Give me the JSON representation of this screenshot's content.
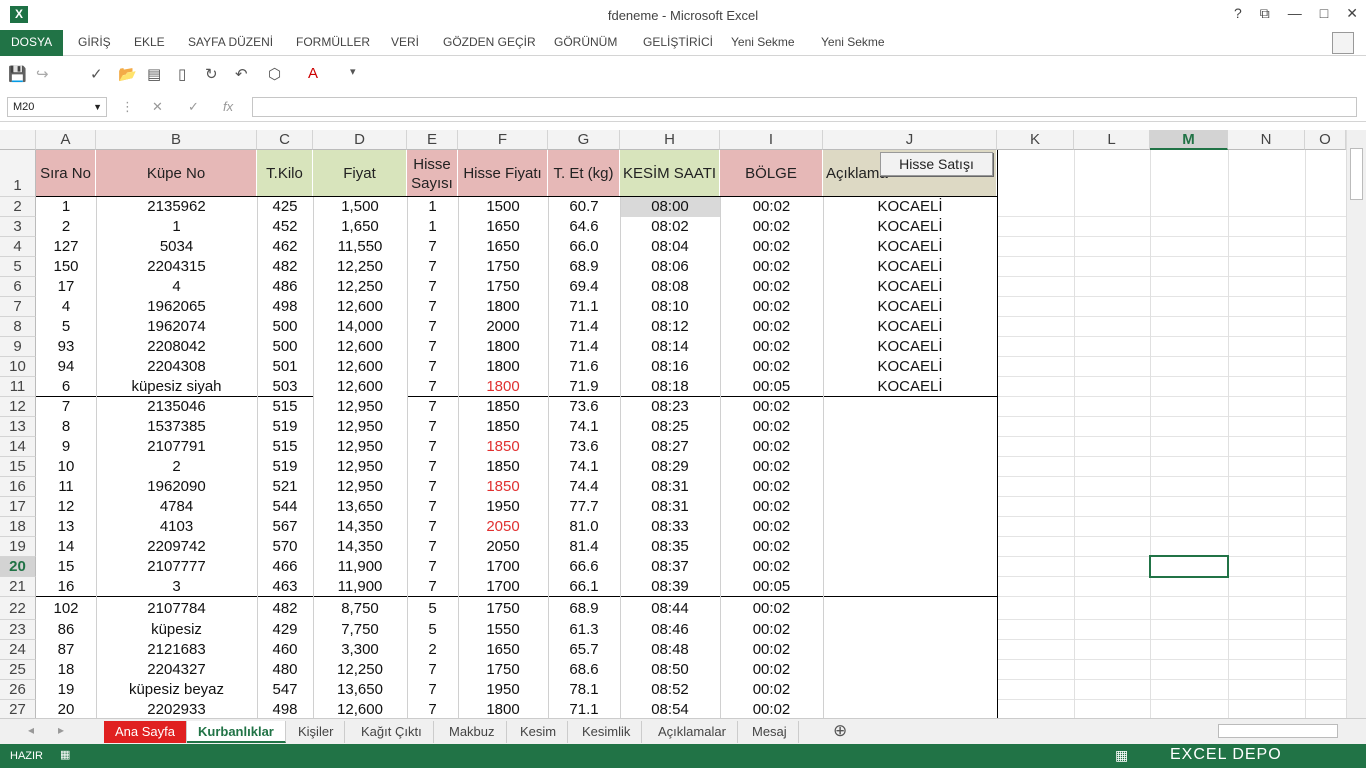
{
  "window": {
    "title": "fdeneme - Microsoft Excel",
    "help": "?",
    "controls": [
      "⧉",
      "—",
      "□",
      "✕"
    ]
  },
  "ribbon": {
    "file": "DOSYA",
    "tabs": [
      "GİRİŞ",
      "EKLE",
      "SAYFA DÜZENİ",
      "FORMÜLLER",
      "VERİ",
      "GÖZDEN GEÇİR",
      "GÖRÜNÜM",
      "GELİŞTİRİCİ",
      "Yeni Sekme",
      "Yeni Sekme"
    ]
  },
  "quick_access": [
    "save-icon",
    "redo-icon",
    "spellcheck-icon",
    "open-icon",
    "form-icon",
    "new-icon",
    "refresh-icon",
    "undo-icon",
    "shapes-icon",
    "font-color-icon",
    "customize-icon"
  ],
  "name_box": "M20",
  "formula_bar": {
    "cancel": "✕",
    "enter": "✓",
    "fx": "fx",
    "value": ""
  },
  "columns": [
    "A",
    "B",
    "C",
    "D",
    "E",
    "F",
    "G",
    "H",
    "I",
    "J",
    "K",
    "L",
    "M",
    "N",
    "O"
  ],
  "selected_column": "M",
  "selected_row": "20",
  "headers": {
    "A": "Sıra No",
    "B": "Küpe No",
    "C": "T.Kilo",
    "D": "Fiyat",
    "E": "Hisse Sayısı",
    "F": "Hisse Fiyatı",
    "G": "T. Et (kg)",
    "H": "KESİM SAATI",
    "I": "BÖLGE",
    "J": "Açıklama"
  },
  "button_label": "Hisse Satışı",
  "rows": [
    {
      "n": "2",
      "a": "1",
      "b": "2135962",
      "c": "425",
      "d": "1,500",
      "e": "1",
      "f": "1500",
      "g": "60.7",
      "h": "08:00",
      "i": "00:02",
      "j": "KOCAELİ"
    },
    {
      "n": "3",
      "a": "2",
      "b": "1",
      "c": "452",
      "d": "1,650",
      "e": "1",
      "f": "1650",
      "g": "64.6",
      "h": "08:02",
      "i": "00:02",
      "j": "KOCAELİ"
    },
    {
      "n": "4",
      "a": "127",
      "b": "5034",
      "c": "462",
      "d": "11,550",
      "e": "7",
      "f": "1650",
      "g": "66.0",
      "h": "08:04",
      "i": "00:02",
      "j": "KOCAELİ"
    },
    {
      "n": "5",
      "a": "150",
      "b": "2204315",
      "c": "482",
      "d": "12,250",
      "e": "7",
      "f": "1750",
      "g": "68.9",
      "h": "08:06",
      "i": "00:02",
      "j": "KOCAELİ"
    },
    {
      "n": "6",
      "a": "17",
      "b": "4",
      "c": "486",
      "d": "12,250",
      "e": "7",
      "f": "1750",
      "g": "69.4",
      "h": "08:08",
      "i": "00:02",
      "j": "KOCAELİ"
    },
    {
      "n": "7",
      "a": "4",
      "b": "1962065",
      "c": "498",
      "d": "12,600",
      "e": "7",
      "f": "1800",
      "g": "71.1",
      "h": "08:10",
      "i": "00:02",
      "j": "KOCAELİ"
    },
    {
      "n": "8",
      "a": "5",
      "b": "1962074",
      "c": "500",
      "d": "14,000",
      "e": "7",
      "f": "2000",
      "g": "71.4",
      "h": "08:12",
      "i": "00:02",
      "j": "KOCAELİ"
    },
    {
      "n": "9",
      "a": "93",
      "b": "2208042",
      "c": "500",
      "d": "12,600",
      "e": "7",
      "f": "1800",
      "g": "71.4",
      "h": "08:14",
      "i": "00:02",
      "j": "KOCAELİ"
    },
    {
      "n": "10",
      "a": "94",
      "b": "2204308",
      "c": "501",
      "d": "12,600",
      "e": "7",
      "f": "1800",
      "g": "71.6",
      "h": "08:16",
      "i": "00:02",
      "j": "KOCAELİ"
    },
    {
      "n": "11",
      "a": "6",
      "b": "küpesiz siyah",
      "c": "503",
      "d": "12,600",
      "e": "7",
      "f": "1800",
      "g": "71.9",
      "h": "08:18",
      "i": "00:05",
      "j": "KOCAELİ",
      "fred": true
    },
    {
      "n": "12",
      "a": "7",
      "b": "2135046",
      "c": "515",
      "d": "12,950",
      "e": "7",
      "f": "1850",
      "g": "73.6",
      "h": "08:23",
      "i": "00:02",
      "j": ""
    },
    {
      "n": "13",
      "a": "8",
      "b": "1537385",
      "c": "519",
      "d": "12,950",
      "e": "7",
      "f": "1850",
      "g": "74.1",
      "h": "08:25",
      "i": "00:02",
      "j": ""
    },
    {
      "n": "14",
      "a": "9",
      "b": "2107791",
      "c": "515",
      "d": "12,950",
      "e": "7",
      "f": "1850",
      "g": "73.6",
      "h": "08:27",
      "i": "00:02",
      "j": "",
      "fred": true
    },
    {
      "n": "15",
      "a": "10",
      "b": "2",
      "c": "519",
      "d": "12,950",
      "e": "7",
      "f": "1850",
      "g": "74.1",
      "h": "08:29",
      "i": "00:02",
      "j": ""
    },
    {
      "n": "16",
      "a": "11",
      "b": "1962090",
      "c": "521",
      "d": "12,950",
      "e": "7",
      "f": "1850",
      "g": "74.4",
      "h": "08:31",
      "i": "00:02",
      "j": "",
      "fred": true
    },
    {
      "n": "17",
      "a": "12",
      "b": "4784",
      "c": "544",
      "d": "13,650",
      "e": "7",
      "f": "1950",
      "g": "77.7",
      "h": "08:31",
      "i": "00:02",
      "j": ""
    },
    {
      "n": "18",
      "a": "13",
      "b": "4103",
      "c": "567",
      "d": "14,350",
      "e": "7",
      "f": "2050",
      "g": "81.0",
      "h": "08:33",
      "i": "00:02",
      "j": "",
      "fred": true
    },
    {
      "n": "19",
      "a": "14",
      "b": "2209742",
      "c": "570",
      "d": "14,350",
      "e": "7",
      "f": "2050",
      "g": "81.4",
      "h": "08:35",
      "i": "00:02",
      "j": ""
    },
    {
      "n": "20",
      "a": "15",
      "b": "2107777",
      "c": "466",
      "d": "11,900",
      "e": "7",
      "f": "1700",
      "g": "66.6",
      "h": "08:37",
      "i": "00:02",
      "j": ""
    },
    {
      "n": "21",
      "a": "16",
      "b": "3",
      "c": "463",
      "d": "11,900",
      "e": "7",
      "f": "1700",
      "g": "66.1",
      "h": "08:39",
      "i": "00:05",
      "j": ""
    },
    {
      "n": "22",
      "a": "102",
      "b": "2107784",
      "c": "482",
      "d": "8,750",
      "e": "5",
      "f": "1750",
      "g": "68.9",
      "h": "08:44",
      "i": "00:02",
      "j": ""
    },
    {
      "n": "23",
      "a": "86",
      "b": "küpesiz",
      "c": "429",
      "d": "7,750",
      "e": "5",
      "f": "1550",
      "g": "61.3",
      "h": "08:46",
      "i": "00:02",
      "j": ""
    },
    {
      "n": "24",
      "a": "87",
      "b": "2121683",
      "c": "460",
      "d": "3,300",
      "e": "2",
      "f": "1650",
      "g": "65.7",
      "h": "08:48",
      "i": "00:02",
      "j": ""
    },
    {
      "n": "25",
      "a": "18",
      "b": "2204327",
      "c": "480",
      "d": "12,250",
      "e": "7",
      "f": "1750",
      "g": "68.6",
      "h": "08:50",
      "i": "00:02",
      "j": ""
    },
    {
      "n": "26",
      "a": "19",
      "b": "küpesiz beyaz",
      "c": "547",
      "d": "13,650",
      "e": "7",
      "f": "1950",
      "g": "78.1",
      "h": "08:52",
      "i": "00:02",
      "j": ""
    },
    {
      "n": "27",
      "a": "20",
      "b": "2202933",
      "c": "498",
      "d": "12,600",
      "e": "7",
      "f": "1800",
      "g": "71.1",
      "h": "08:54",
      "i": "00:02",
      "j": ""
    }
  ],
  "sheets": [
    {
      "label": "Ana Sayfa",
      "style": "red"
    },
    {
      "label": "Kurbanlıklar",
      "style": "active"
    },
    {
      "label": "Kişiler",
      "style": ""
    },
    {
      "label": "Kağıt Çıktı",
      "style": ""
    },
    {
      "label": "Makbuz",
      "style": ""
    },
    {
      "label": "Kesim",
      "style": ""
    },
    {
      "label": "Kesimlik",
      "style": ""
    },
    {
      "label": "Açıklamalar",
      "style": ""
    },
    {
      "label": "Mesaj",
      "style": ""
    }
  ],
  "add_sheet": "⊕",
  "status": {
    "ready": "HAZIR",
    "watermark": "EXCEL DEPO"
  },
  "colors": {
    "accent": "#217346",
    "header_pink": "#e6b8b7",
    "header_green": "#d8e4bc",
    "header_beige": "#ddd9c4",
    "red_text": "#e03030",
    "red_tab": "#e02020"
  }
}
